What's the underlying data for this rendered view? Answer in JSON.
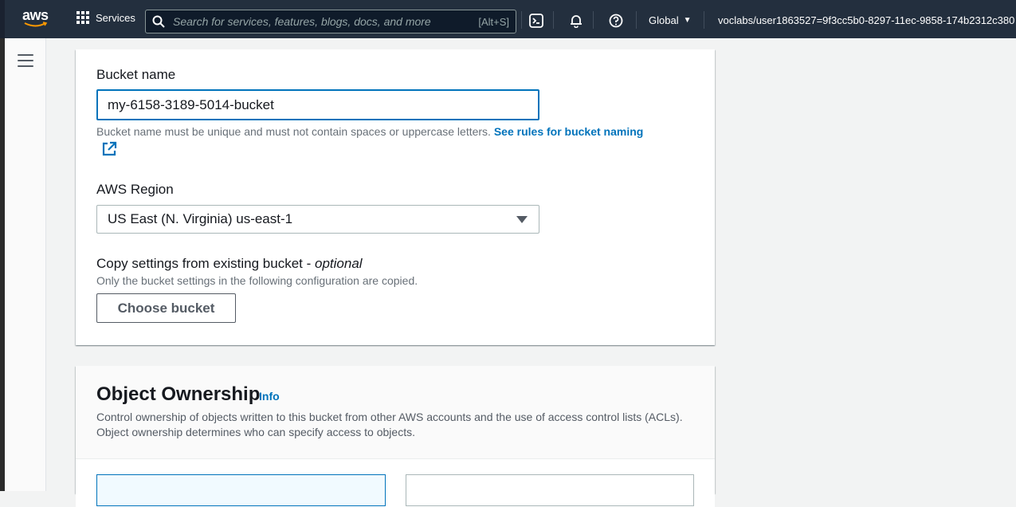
{
  "topnav": {
    "logo_text": "aws",
    "services_label": "Services",
    "search_placeholder": "Search for services, features, blogs, docs, and more",
    "search_shortcut": "[Alt+S]",
    "region_label": "Global",
    "account_label": "voclabs/user1863527=9f3cc5b0-8297-11ec-9858-174b2312c380 @"
  },
  "bucket": {
    "name_label": "Bucket name",
    "name_value": "my-6158-3189-5014-bucket",
    "name_hint": "Bucket name must be unique and must not contain spaces or uppercase letters.",
    "rules_link": "See rules for bucket naming",
    "region_label": "AWS Region",
    "region_value": "US East (N. Virginia) us-east-1",
    "copy_label": "Copy settings from existing bucket - ",
    "copy_optional": "optional",
    "copy_hint": "Only the bucket settings in the following configuration are copied.",
    "choose_button": "Choose bucket"
  },
  "ownership": {
    "title": "Object Ownership",
    "info_link": "Info",
    "description": "Control ownership of objects written to this bucket from other AWS accounts and the use of access control lists (ACLs). Object ownership determines who can specify access to objects."
  },
  "colors": {
    "nav_bg": "#232f3e",
    "link": "#0073bb",
    "focus_border": "#0073bb"
  }
}
